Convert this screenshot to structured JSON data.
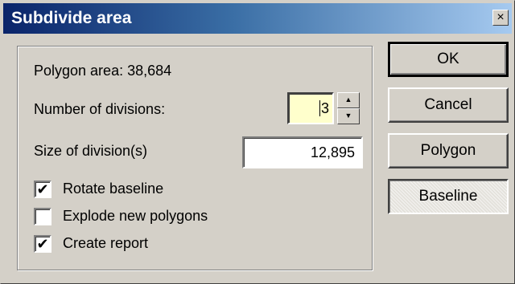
{
  "window": {
    "title": "Subdivide area",
    "close_glyph": "×"
  },
  "group": {
    "polygon_area_label": "Polygon area: 38,684",
    "divisions_label": "Number of divisions:",
    "divisions_value": "3",
    "size_label": "Size of division(s)",
    "size_value": "12,895"
  },
  "checkboxes": [
    {
      "label": "Rotate baseline",
      "checked": true,
      "mark": "✔"
    },
    {
      "label": "Explode new polygons",
      "checked": false,
      "mark": ""
    },
    {
      "label": "Create report",
      "checked": true,
      "mark": "✔"
    }
  ],
  "buttons": {
    "ok": "OK",
    "cancel": "Cancel",
    "polygon": "Polygon",
    "baseline": "Baseline"
  },
  "spinner": {
    "up": "▲",
    "down": "▼"
  },
  "colors": {
    "title_start": "#0a246a",
    "title_end": "#a6caf0",
    "dialog_bg": "#d4d0c8",
    "active_input_bg": "#ffffcc"
  }
}
